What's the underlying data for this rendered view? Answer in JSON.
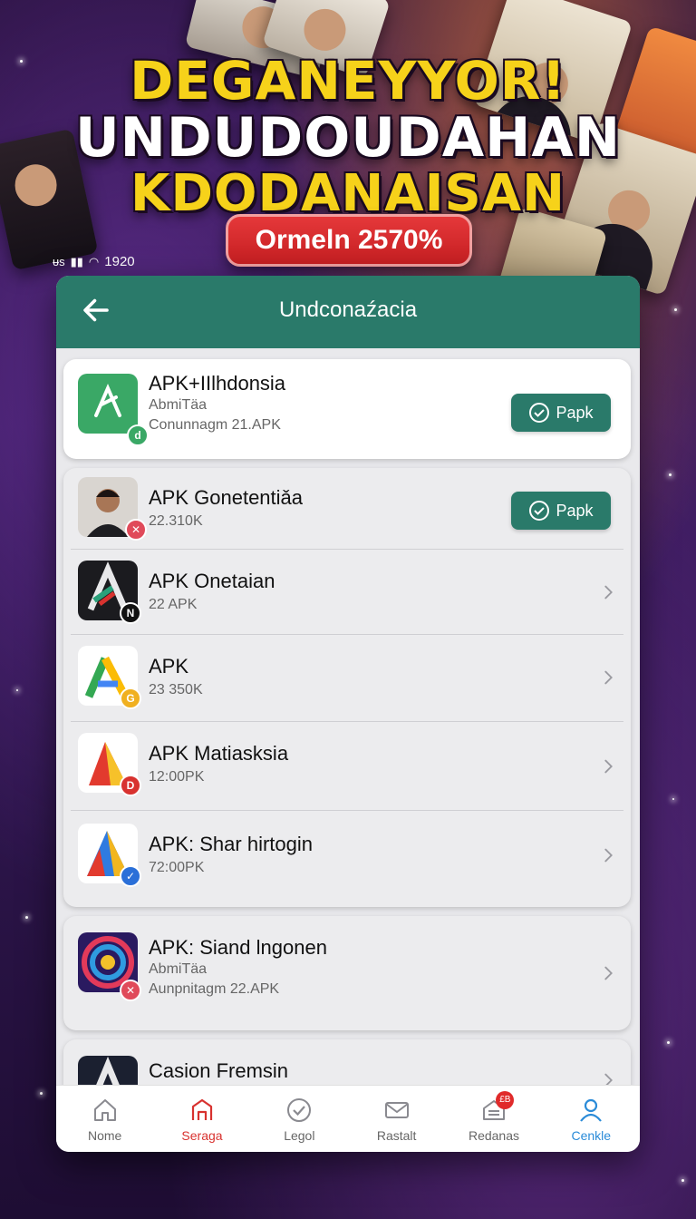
{
  "promo": {
    "headline_line1": "DEGANEYYOR!",
    "headline_line2": "UNDUDOUDAHAN",
    "headline_line3": "KDODANAISAN",
    "pill_text": "Ormeln 2570%"
  },
  "status_bar": {
    "left_icons": "ᵾs",
    "time": "1920"
  },
  "header": {
    "title": "Undconaźacia"
  },
  "apps": [
    {
      "name": "APK+IIlhdonsia",
      "line1": "AbmiTäa",
      "line2": "Conunnagm 21.APK",
      "action": "Papk",
      "icon": "green-a-icon"
    },
    {
      "name": "APK Gonetentiǎa",
      "line1": "22.310K",
      "action": "Papk",
      "icon": "person-photo-icon"
    },
    {
      "name": "APK Onetaian",
      "line1": "22 APK",
      "icon": "dark-a-icon"
    },
    {
      "name": "APK",
      "line1": "23 350K",
      "icon": "google-a-icon"
    },
    {
      "name": "APK Matiasksia",
      "line1": "12:00PK",
      "icon": "red-a-icon"
    },
    {
      "name": "APK: Shar hirtogin",
      "line1": "72:00PK",
      "icon": "blue-a-icon"
    },
    {
      "name": "APK: Siand lngonen",
      "line1": "AbmiTäa",
      "line2": "Aunpnitagm 22.APK",
      "icon": "swirl-icon"
    },
    {
      "name": "Casion Fremsin",
      "icon": "casino-a-icon"
    }
  ],
  "nav": {
    "items": [
      {
        "label": "Nome"
      },
      {
        "label": "Seraga"
      },
      {
        "label": "Legol"
      },
      {
        "label": "Rastalt"
      },
      {
        "label": "Redanas",
        "badge": "£B"
      },
      {
        "label": "Cenkle"
      }
    ]
  },
  "colors": {
    "brand_green": "#2a7a6a",
    "accent_red": "#d8322f",
    "accent_blue": "#2a8bd8",
    "headline_yellow": "#f6d21a"
  }
}
